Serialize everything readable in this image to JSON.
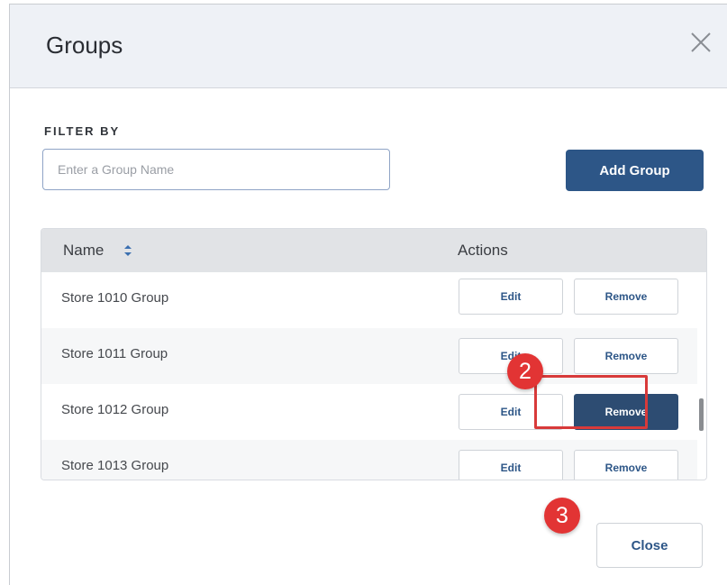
{
  "dialog": {
    "title": "Groups",
    "close_icon": "close-icon"
  },
  "filter": {
    "label": "FILTER BY",
    "placeholder": "Enter a Group Name",
    "value": ""
  },
  "toolbar": {
    "add_group_label": "Add Group"
  },
  "table": {
    "columns": [
      "Name",
      "Actions"
    ],
    "sort_icon": "sort-icon",
    "rows": [
      {
        "name": "Store 1010 Group",
        "edit": "Edit",
        "remove": "Remove"
      },
      {
        "name": "Store 1011 Group",
        "edit": "Edit",
        "remove": "Remove"
      },
      {
        "name": "Store 1012 Group",
        "edit": "Edit",
        "remove": "Remove"
      },
      {
        "name": "Store 1013 Group",
        "edit": "Edit",
        "remove": "Remove"
      }
    ]
  },
  "annotations": {
    "step_two": "2",
    "step_three": "3",
    "highlight_color": "#d83a3a"
  },
  "footer": {
    "close_label": "Close"
  },
  "colors": {
    "primary": "#2d5687",
    "header_bg": "#eef1f6"
  }
}
